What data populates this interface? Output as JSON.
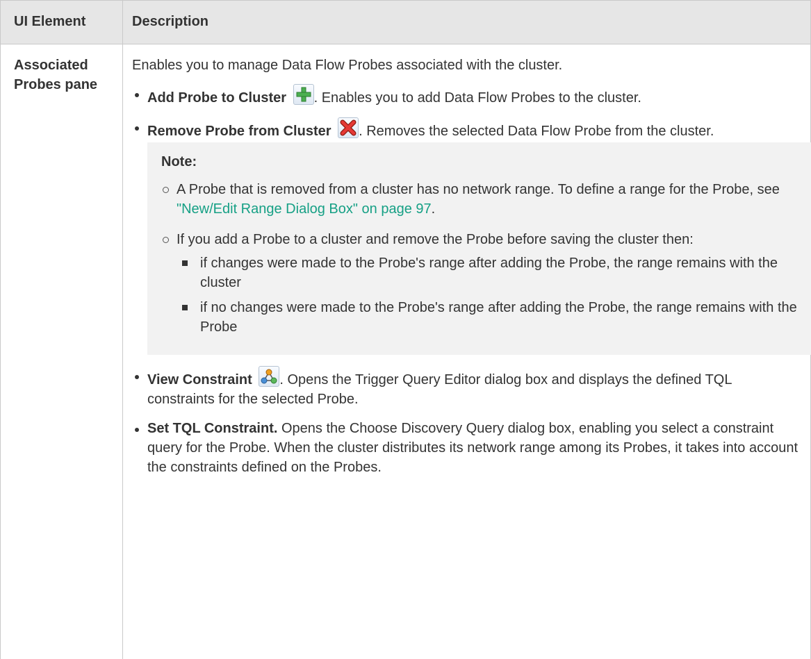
{
  "table": {
    "headers": {
      "element": "UI Element",
      "description": "Description"
    }
  },
  "row": {
    "element_name": "Associated Probes pane",
    "intro": "Enables you to manage Data Flow Probes associated with the cluster.",
    "items": [
      {
        "label": "Add Probe to Cluster",
        "icon": "add-icon",
        "text": ". Enables you to add Data Flow Probes to the cluster."
      },
      {
        "label": "Remove Probe from Cluster",
        "icon": "remove-icon",
        "text": ". Removes the selected Data Flow Probe from the cluster."
      },
      {
        "label": "View Constraint",
        "icon": "view-constraint-icon",
        "text": ". Opens the Trigger Query Editor dialog box and displays the defined TQL constraints for the selected Probe."
      },
      {
        "label": "Set TQL Constraint.",
        "text": " Opens the Choose Discovery Query dialog box, enabling you select a constraint query for the Probe. When the cluster distributes its network range among its Probes, it takes into account the constraints defined on the Probes."
      }
    ],
    "note": {
      "title": "Note:",
      "item1_text": "A Probe that is removed from a cluster has no network range. To define a range for the Probe, see ",
      "item1_link": "\"New/Edit Range Dialog Box\" on page 97",
      "item1_end": ".",
      "item2_text": "If you add a Probe to a cluster and remove the Probe before saving the cluster then:",
      "subitems": [
        "if changes were made to the Probe's range after adding the Probe, the range remains with the cluster",
        "if no changes were made to the Probe's range after adding the Probe, the range remains with the Probe"
      ]
    }
  },
  "colors": {
    "link": "#16a085",
    "header_bg": "#e6e6e6",
    "note_bg": "#f2f2f2",
    "border": "#c9c9c9"
  }
}
